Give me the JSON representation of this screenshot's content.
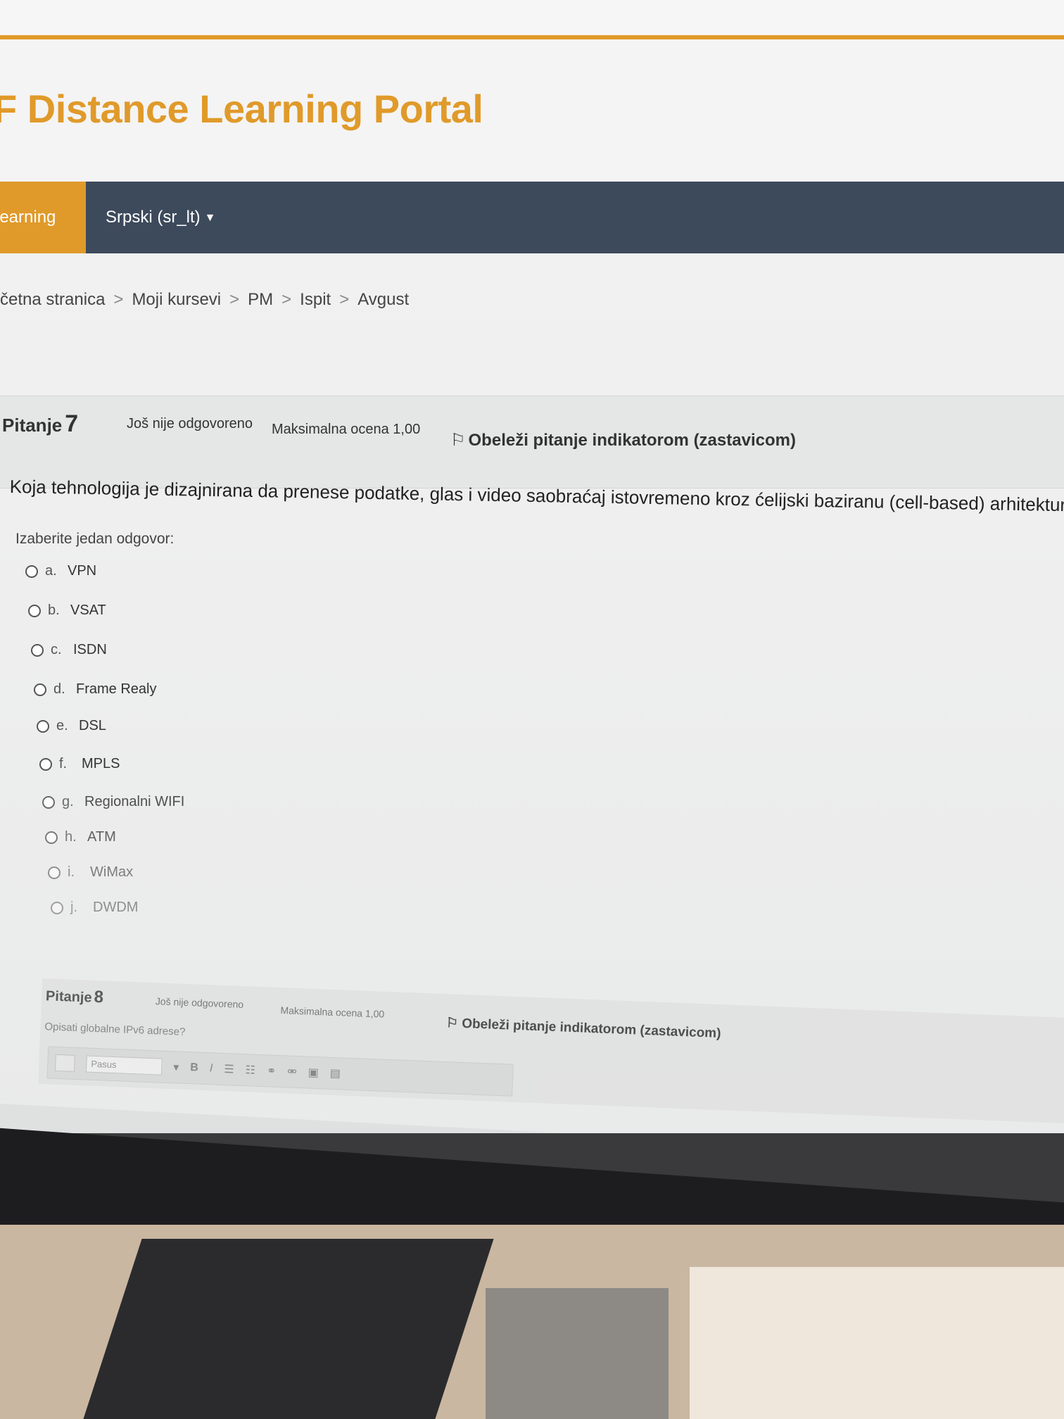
{
  "portal": {
    "title": "AF Distance Learning Portal",
    "title_visible": "F Distance Learning Portal"
  },
  "nav": {
    "home_label": "learning",
    "language_label": "Srpski (sr_lt)"
  },
  "breadcrumb": [
    "četna stranica",
    "Moji kursevi",
    "PM",
    "Ispit",
    "Avgust"
  ],
  "question7": {
    "label": "Pitanje",
    "number": "7",
    "state": "Još nije odgovoreno",
    "grade": "Maksimalna ocena 1,00",
    "flag_label": "Obeleži pitanje indikatorom (zastavicom)",
    "text": "Koja tehnologija je dizajnirana da prenese podatke, glas i video saobraćaj istovremeno kroz ćelijski baziranu (cell-based) arhitekturu?",
    "prompt": "Izaberite jedan odgovor:",
    "answers": [
      {
        "letter": "a.",
        "text": "VPN"
      },
      {
        "letter": "b.",
        "text": "VSAT"
      },
      {
        "letter": "c.",
        "text": "ISDN"
      },
      {
        "letter": "d.",
        "text": "Frame Realy"
      },
      {
        "letter": "e.",
        "text": "DSL"
      },
      {
        "letter": "f.",
        "text": "MPLS"
      },
      {
        "letter": "g.",
        "text": "Regionalni WIFI"
      },
      {
        "letter": "h.",
        "text": "ATM"
      },
      {
        "letter": "i.",
        "text": "WiMax"
      },
      {
        "letter": "j.",
        "text": "DWDM"
      }
    ]
  },
  "question8": {
    "label": "Pitanje",
    "number": "8",
    "state": "Još nije odgovoreno",
    "grade": "Maksimalna ocena 1,00",
    "flag_label": "Obeleži pitanje indikatorom (zastavicom)",
    "text": "Opisati globalne IPv6 adrese?",
    "editor_paragraph": "Pasus"
  },
  "taskbar": {
    "icons": [
      "windows-start-icon",
      "search-icon",
      "file-explorer-icon",
      "teams-meet-icon",
      "folder-icon",
      "edge-icon",
      "store-icon"
    ]
  },
  "colors": {
    "accent": "#e09a2a",
    "navbar": "#3d4a5c"
  }
}
